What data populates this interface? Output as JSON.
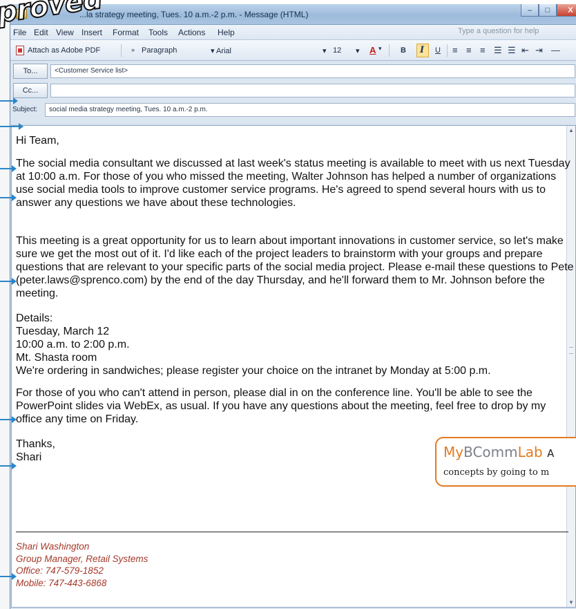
{
  "stamp": {
    "text": "proved"
  },
  "window": {
    "title": "...la strategy meeting, Tues. 10 a.m.-2 p.m. - Message (HTML)",
    "controls": [
      "–",
      "□",
      "X"
    ]
  },
  "menu": {
    "items": [
      "File",
      "Edit",
      "View",
      "Insert",
      "Format",
      "Tools",
      "Actions",
      "Help"
    ],
    "help_placeholder": "Type a question for help"
  },
  "toolbar": {
    "attach_pdf": "Attach as Adobe PDF",
    "style": "Paragraph",
    "font": "Arial",
    "size": "12",
    "bold": "B",
    "italic": "I",
    "underline": "U"
  },
  "address": {
    "to_label": "To...",
    "to_value": "<Customer Service list>",
    "cc_label": "Cc...",
    "cc_value": "",
    "subject_label": "Subject:",
    "subject_value": "social media strategy meeting, Tues. 10 a.m.-2 p.m."
  },
  "message": {
    "greeting": "Hi Team,",
    "para1": "The social media consultant we discussed at last week's status meeting is available to meet with us next Tuesday at 10:00 a.m. For those of you who missed the meeting, Walter Johnson has helped a number of organizations use social media tools to improve customer service programs. He's agreed to spend several hours with us to answer any questions we have about these technologies.",
    "para2": "This meeting is a great opportunity for us to learn about important innovations in customer service, so let's make sure we get the most out of it. I'd like each of the project leaders to brainstorm with your groups and prepare questions that are relevant to your specific parts of the social media project. Please e-mail these questions to Pete (peter.laws@sprenco.com) by the end of the day Thursday, and he'll forward them to Mr. Johnson before the meeting.",
    "details": [
      "Details:",
      "Tuesday, March 12",
      "10:00 a.m. to 2:00 p.m.",
      "Mt. Shasta room",
      "We're ordering in sandwiches; please register your choice on the intranet by Monday at 5:00 p.m."
    ],
    "para3": "For those of you who can't attend in person, please dial in on the conference line. You'll be able to see the PowerPoint slides via WebEx, as usual. If you have any questions about the meeting, feel free to drop by my office any time on Friday.",
    "closing": [
      "Thanks,",
      "Shari"
    ]
  },
  "signature": [
    "Shari Washington",
    "Group Manager, Retail Systems",
    "Office: 747-579-1852",
    "Mobile: 747-443-6868"
  ],
  "mylab": {
    "my": "My",
    "bcomm": "BComm",
    "lab": "Lab",
    "tail": "A",
    "line2": "concepts by going to m"
  },
  "colors": {
    "accent_blue": "#2a86c9",
    "signature_red": "#a5392a",
    "mylab_orange": "#e27b1f"
  }
}
